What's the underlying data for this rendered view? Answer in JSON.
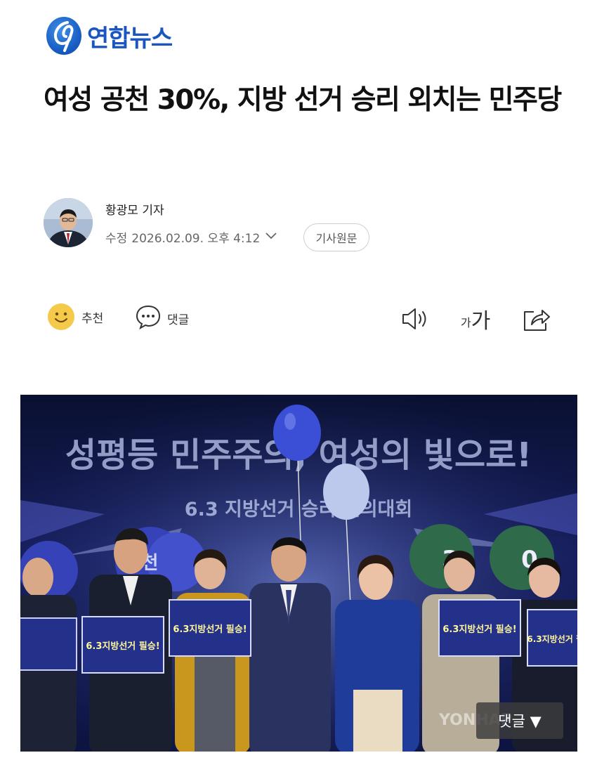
{
  "brand": {
    "name": "연합뉴스"
  },
  "article": {
    "headline": "여성 공천 30%, 지방 선거 승리 외치는 민주당",
    "reporter": "황광모 기자",
    "modified_label": "수정",
    "date": "2026.02.09. 오후 4:12",
    "original_button": "기사원문"
  },
  "actions": {
    "recommend_label": "추천",
    "comment_label": "댓글",
    "font_size_small": "가",
    "font_size_large": "가"
  },
  "photo": {
    "banner_main": "성평등 민주주의, 여성의 빛으로!",
    "banner_sub": "6.3 지방선거 승리 결의대회",
    "placards": [
      "6.3지방선거 필승!",
      "6.3지방선거 필승!",
      "6.3지방선거 필승!",
      "6.3지방선거 필승!"
    ],
    "left_circle_text": "공 천",
    "right_circle_digits": [
      "3",
      "0"
    ],
    "watermark": "YONHAP",
    "comments_chip": "댓글 ▼"
  },
  "colors": {
    "brand_blue": "#1a56c0",
    "stage_dark": "#0b1236",
    "placard_blue": "#23318a"
  }
}
